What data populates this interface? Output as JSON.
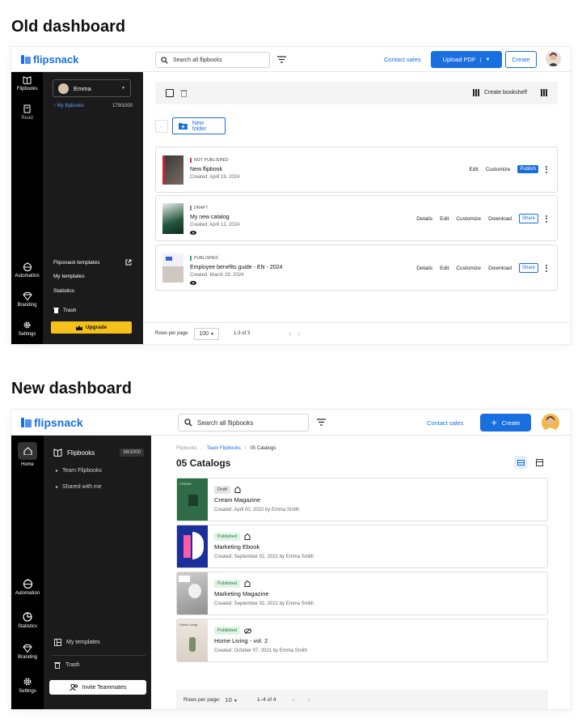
{
  "old": {
    "heading": "Old dashboard",
    "brand": "flipsnack",
    "search_placeholder": "Search all flipbooks",
    "contact_sales": "Contact sales",
    "upload_label": "Upload PDF",
    "create_label": "Create",
    "rail": [
      {
        "label": "Flipbooks",
        "icon": "book-open-icon"
      },
      {
        "label": "Read",
        "icon": "book-icon"
      },
      {
        "label": "Automation",
        "icon": "robot-icon"
      },
      {
        "label": "Branding",
        "icon": "diamond-icon"
      },
      {
        "label": "Settings",
        "icon": "gear-icon"
      }
    ],
    "user": "Emma",
    "my_flipbooks": "My flipbooks",
    "flipbook_count": "179/1000",
    "panel_links": [
      "Flipsnack templates",
      "My templates",
      "Statistics"
    ],
    "trash": "Trash",
    "upgrade": "Upgrade",
    "create_bookshelf": "Create bookshelf",
    "new_folder": "New folder",
    "items": [
      {
        "status": "NOT PUBLISHED",
        "status_color": "#e2314a",
        "title": "New flipbook",
        "created": "Created: April 19, 2024",
        "actions": [
          "Edit",
          "Customize"
        ],
        "pill": "Publish"
      },
      {
        "status": "DRAFT",
        "status_color": "#8a8a8a",
        "title": "My new catalog",
        "created": "Created: April 12, 2024",
        "actions": [
          "Details",
          "Edit",
          "Customize",
          "Download"
        ],
        "pill": "Share"
      },
      {
        "status": "PUBLISHED",
        "status_color": "#27b36a",
        "title": "Employee benefits guide - EN - 2024",
        "created": "Created: March 29, 2024",
        "actions": [
          "Details",
          "Edit",
          "Customize",
          "Download"
        ],
        "pill": "Share"
      }
    ],
    "rows_per_page_label": "Rows per page",
    "rows_per_page_value": "100",
    "range": "1-3 of 3"
  },
  "new": {
    "heading": "New dashboard",
    "brand": "flipsnack",
    "search_placeholder": "Search all flipbooks",
    "contact_sales": "Contact sales",
    "create_label": "Create",
    "rail": [
      {
        "label": "Home",
        "icon": "home-icon"
      },
      {
        "label": "Automation",
        "icon": "robot-icon"
      },
      {
        "label": "Statistics",
        "icon": "pie-chart-icon"
      },
      {
        "label": "Branding",
        "icon": "diamond-icon"
      },
      {
        "label": "Settings",
        "icon": "gear-icon"
      }
    ],
    "flipbooks": "Flipbooks",
    "flipbook_count": "38/1000",
    "tree": [
      "Team Flipbooks",
      "Shared with me"
    ],
    "my_templates": "My templates",
    "trash": "Trash",
    "invite": "Invite Teammates",
    "breadcrumb": [
      "Flipbooks",
      "Team Flipbooks",
      "05 Catalogs"
    ],
    "breadcrumb_sep": "/",
    "page_title": "05 Catalogs",
    "items": [
      {
        "status": "Draft",
        "title": "Cream Magazine",
        "created": "Created: April 00, 2022 by Emma Smith"
      },
      {
        "status": "Published",
        "title": "Marketing Ebook",
        "created": "Created: September 02, 2021 by Emma Smith"
      },
      {
        "status": "Published",
        "title": "Marketing Magazine",
        "created": "Created: September 02, 2021 by Emma Smith"
      },
      {
        "status": "Published",
        "title": "Home Living - vol. 2",
        "created": "Created: October 07, 2021 by Emma Smith"
      }
    ],
    "rows_per_page_label": "Rows per page:",
    "rows_per_page_value": "10",
    "range": "1–4 of 4",
    "thumb_texts": [
      "CREAM",
      "Home Living"
    ]
  },
  "colors": {
    "accent": "#1a6fe0",
    "upgrade": "#f5c21b",
    "published_bg": "#dff3e4",
    "published_fg": "#1f7a3c",
    "draft_bg": "#e6e6e6"
  }
}
